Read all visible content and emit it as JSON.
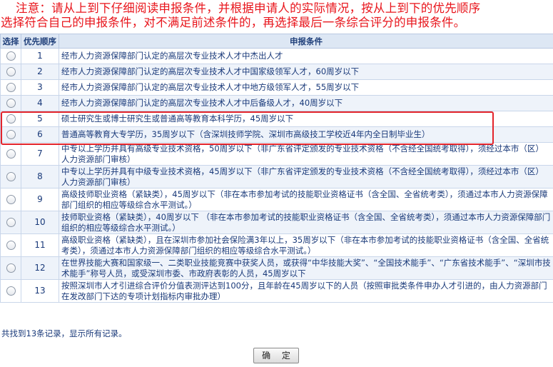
{
  "notice": {
    "line1": "注意：请从上到下仔细阅读申报条件，并根据申请人的实际情况，按从上到下的优先顺序",
    "line2": "选择符合自己的申报条件，对不满足前述条件的，再选择最后一条综合评分的申报条件。"
  },
  "table": {
    "headers": {
      "select": "选择",
      "order": "优先顺序",
      "condition": "申报条件"
    },
    "rows": [
      {
        "order": "1",
        "text": "经市人力资源保障部门认定的高层次专业技术人才中杰出人才"
      },
      {
        "order": "2",
        "text": "经市人力资源保障部门认定的高层次专业技术人才中国家级领军人才，60周岁以下"
      },
      {
        "order": "3",
        "text": "经市人力资源保障部门认定的高层次专业技术人才中地方级领军人才，55周岁以下"
      },
      {
        "order": "4",
        "text": "经市人力资源保障部门认定的高层次专业技术人才中后备级人才，40周岁以下"
      },
      {
        "order": "5",
        "text": "硕士研究生或博士研究生或普通高等教育本科学历，45周岁以下"
      },
      {
        "order": "6",
        "text": "普通高等教育大专学历，35周岁以下（含深圳技师学院、深圳市高级技工学校近4年内全日制毕业生）"
      },
      {
        "order": "7",
        "text": "中专以上学历并具有高级专业技术资格，50周岁以下（非广东省评定颁发的专业技术资格（不含经全国统考取得），须经过本市（区）人力资源部门审核）"
      },
      {
        "order": "8",
        "text": "中专以上学历并具有中级专业技术资格，45周岁以下（非广东省评定颁发的专业技术资格（不含经全国统考取得），须经过本市（区）人力资源部门审核）"
      },
      {
        "order": "9",
        "text": "高级技师职业资格（紧缺类），45周岁以下（非在本市参加考试的技能职业资格证书（含全国、全省统考类），须通过本市人力资源保障部门组织的相应等级综合水平测试。）"
      },
      {
        "order": "10",
        "text": "技师职业资格（紧缺类），40周岁以下 （非在本市参加考试的技能职业资格证书（含全国、全省统考类），须通过本市人力资源保障部门组织的相应等级综合水平测试。）"
      },
      {
        "order": "11",
        "text": "高级职业资格（紧缺类），且在深圳市参加社会保险满3年以上，35周岁以下（非在本市参加考试的技能职业资格证书（含全国、全省统考类），须通过本市人力资源保障部门组织的相应等级综合水平测试。）"
      },
      {
        "order": "12",
        "text": "在世界技能大赛和国家级一、二类职业技能竞赛中获奖人员，或获得“中华技能大奖”、“全国技术能手”、“广东省技术能手”、“深圳市技术能手”称号人员，或受深圳市委、市政府表彰的人员，45周岁以下"
      },
      {
        "order": "13",
        "text": "按照深圳市人才引进综合评价分值表测评达到100分，且年龄在45周岁以下的人员（按照审批类条件申办人才引进的，由人力资源部门在发改部门下达的专项计划指标内审批办理）"
      }
    ]
  },
  "footer": {
    "record_text": "共找到13条记录，显示所有记录。",
    "confirm_label": "确 定"
  }
}
